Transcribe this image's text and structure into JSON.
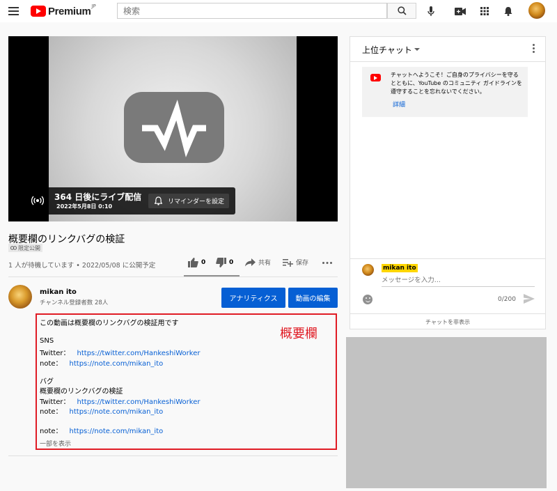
{
  "header": {
    "logo_text": "Premium",
    "logo_region": "JP",
    "search_placeholder": "検索"
  },
  "player": {
    "live_title": "364 日後にライブ配信",
    "live_date": "2022年5月8日 0:10",
    "reminder_label": "リマインダーを設定"
  },
  "video": {
    "title": "概要欄のリンクバグの検証",
    "visibility": "限定公開",
    "waiting_info": "1 人が待機しています • 2022/05/08 に公開予定",
    "like_count": "0",
    "dislike_count": "0",
    "share_label": "共有",
    "save_label": "保存"
  },
  "channel": {
    "name": "mikan ito",
    "subscribers": "チャンネル登録者数 28人",
    "analytics_label": "アナリティクス",
    "edit_label": "動画の編集"
  },
  "description": {
    "annotation": "概要欄",
    "intro": "この動画は概要欄のリンクバグの検証用です",
    "sns_heading": "SNS",
    "twitter_label_1": "Twitter：",
    "twitter_url_1": "https://twitter.com/HankeshiWorker",
    "note_label_1": "note：",
    "note_url_1": "https://note.com/mikan_ito",
    "bug_heading": "バグ",
    "bug_title": "概要欄のリンクバグの検証",
    "twitter_label_2": "Twitter：",
    "twitter_url_2": "https://twitter.com/HankeshiWorker",
    "note_label_2": "note：",
    "note_url_2": "https://note.com/mikan_ito",
    "note_label_3": "note：",
    "note_url_3": "https://note.com/mikan_ito",
    "show_less": "一部を表示"
  },
  "chat": {
    "header_title": "上位チャット",
    "welcome_text": "チャットへようこそ！ご自身のプライバシーを守るとともに、YouTube のコミュニティ ガイドラインを遵守することを忘れないでください。",
    "welcome_link": "詳細",
    "username": "mikan ito",
    "input_placeholder": "メッセージを入力...",
    "counter": "0/200",
    "hide_label": "チャットを非表示"
  },
  "colors": {
    "brand_red": "#ff0000",
    "link_blue": "#065fd4",
    "annotation_red": "#e01b24",
    "username_highlight": "#ffd600"
  }
}
